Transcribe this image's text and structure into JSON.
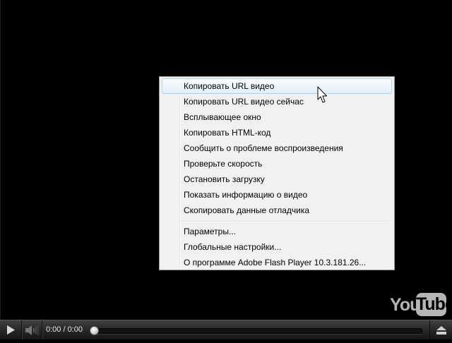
{
  "player": {
    "time_display": "0:00 / 0:00",
    "progress": 0
  },
  "logo": {
    "part1": "You",
    "part2": "Tube"
  },
  "context_menu": {
    "group1": [
      "Копировать URL видео",
      "Копировать URL видео сейчас",
      "Всплывающее окно",
      "Копировать HTML-код",
      "Сообщить о проблеме воспроизведения",
      "Проверьте скорость",
      "Остановить загрузку",
      "Показать информацию о видео",
      "Скопировать данные отладчика"
    ],
    "group2": [
      "Параметры...",
      "Глобальные настройки...",
      "О программе Adobe Flash Player 10.3.181.26..."
    ],
    "hovered_item": "Копировать URL видео"
  },
  "icons": {
    "play": "play-icon",
    "volume": "volume-icon",
    "fullscreen": "fullscreen-icon",
    "cursor": "mouse-pointer-icon"
  }
}
